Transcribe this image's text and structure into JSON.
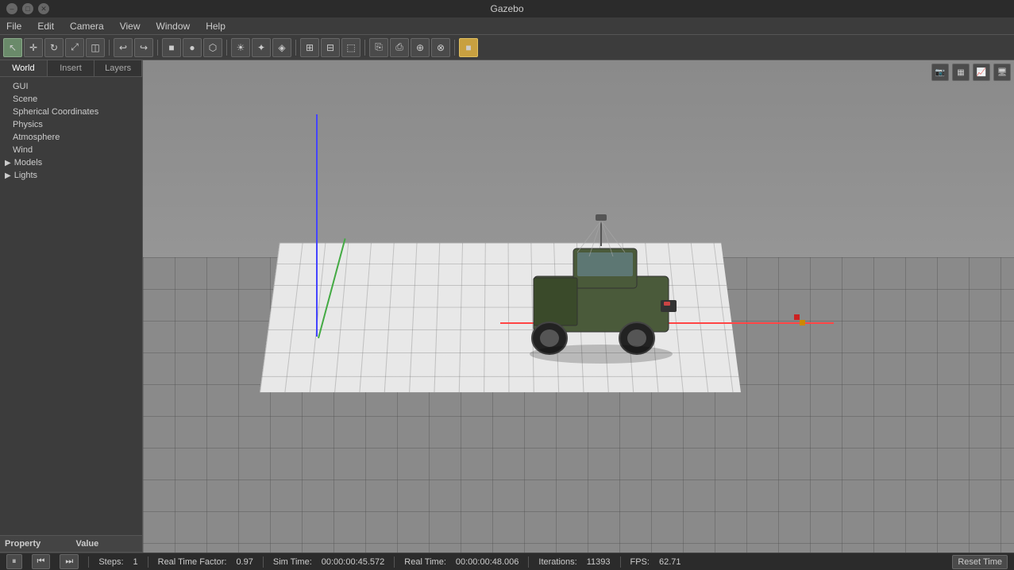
{
  "window": {
    "title": "Gazebo",
    "controls": [
      "minimize",
      "maximize",
      "close"
    ]
  },
  "menu": {
    "items": [
      "File",
      "Edit",
      "Camera",
      "View",
      "Window",
      "Help"
    ]
  },
  "toolbar": {
    "buttons": [
      {
        "name": "select",
        "icon": "↖",
        "active": true
      },
      {
        "name": "translate",
        "icon": "✛"
      },
      {
        "name": "rotate",
        "icon": "↻"
      },
      {
        "name": "scale",
        "icon": "⤢"
      },
      {
        "name": "snap",
        "icon": "◫"
      },
      {
        "name": "sep1",
        "type": "sep"
      },
      {
        "name": "undo",
        "icon": "↩"
      },
      {
        "name": "redo",
        "icon": "↪"
      },
      {
        "name": "sep2",
        "type": "sep"
      },
      {
        "name": "box",
        "icon": "■"
      },
      {
        "name": "sphere",
        "icon": "●"
      },
      {
        "name": "cylinder",
        "icon": "⬡"
      },
      {
        "name": "sep3",
        "type": "sep"
      },
      {
        "name": "sun",
        "icon": "☀"
      },
      {
        "name": "point-light",
        "icon": "✦"
      },
      {
        "name": "spot-light",
        "icon": "◈"
      },
      {
        "name": "sep4",
        "type": "sep"
      },
      {
        "name": "show-all",
        "icon": "⊞"
      },
      {
        "name": "hide-all",
        "icon": "⊟"
      },
      {
        "name": "wireframe",
        "icon": "⬚"
      },
      {
        "name": "sep5",
        "type": "sep"
      },
      {
        "name": "copy",
        "icon": "⎘"
      },
      {
        "name": "paste",
        "icon": "⎙"
      },
      {
        "name": "align",
        "icon": "⊕"
      },
      {
        "name": "snap2",
        "icon": "⊗"
      },
      {
        "name": "record",
        "icon": "⬛",
        "active": true
      }
    ]
  },
  "sidebar": {
    "tabs": [
      "World",
      "Insert",
      "Layers"
    ],
    "active_tab": "World",
    "tree": {
      "items": [
        {
          "label": "GUI",
          "indent": 1,
          "has_arrow": false
        },
        {
          "label": "Scene",
          "indent": 1,
          "has_arrow": false
        },
        {
          "label": "Spherical Coordinates",
          "indent": 1,
          "has_arrow": false
        },
        {
          "label": "Physics",
          "indent": 1,
          "has_arrow": false
        },
        {
          "label": "Atmosphere",
          "indent": 1,
          "has_arrow": false
        },
        {
          "label": "Wind",
          "indent": 1,
          "has_arrow": false
        },
        {
          "label": "Models",
          "indent": 0,
          "has_arrow": true
        },
        {
          "label": "Lights",
          "indent": 0,
          "has_arrow": true
        }
      ]
    },
    "properties": {
      "columns": [
        "Property",
        "Value"
      ],
      "rows": []
    }
  },
  "status_bar": {
    "pause_icon": "⏸",
    "step_back_icon": "⏮",
    "step_forward_icon": "⏭",
    "steps_label": "Steps:",
    "steps_value": "1",
    "real_time_factor_label": "Real Time Factor:",
    "real_time_factor_value": "0.97",
    "sim_time_label": "Sim Time:",
    "sim_time_value": "00:00:00:45.572",
    "real_time_label": "Real Time:",
    "real_time_value": "00:00:00:48.006",
    "iterations_label": "Iterations:",
    "iterations_value": "11393",
    "fps_label": "FPS:",
    "fps_value": "62.71",
    "reset_time_label": "Reset Time"
  },
  "viewport": {
    "right_buttons": [
      "📷",
      "📊",
      "📈",
      "🖥"
    ]
  }
}
